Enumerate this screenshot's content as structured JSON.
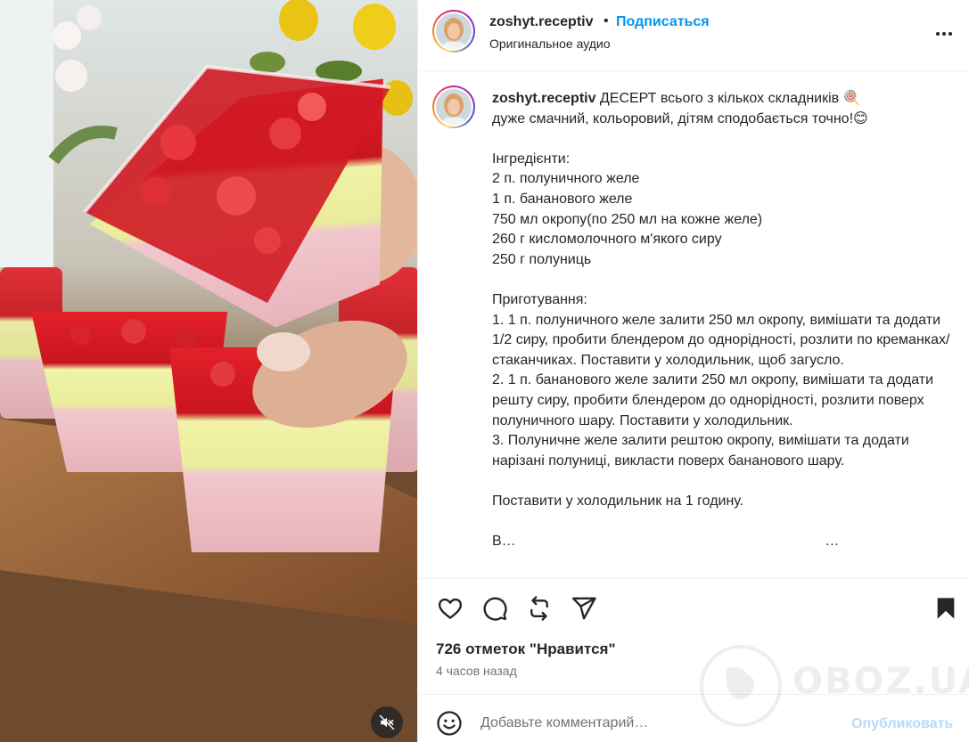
{
  "post": {
    "username": "zoshyt.receptiv",
    "separator": "•",
    "follow_label": "Подписаться",
    "audio_label": "Оригинальное аудио"
  },
  "caption": {
    "username": "zoshyt.receptiv",
    "title": " ДЕСЕРТ всього з кількох складників 🍭",
    "body": "\nдуже смачний, кольоровий, дітям сподобається точно!😊\n\nІнгредієнти:\n2 п. полуничного желе\n1 п. бананового желе\n750 мл окропу(по 250 мл на кожне желе)\n260 г кисломолочного м'якого сиру\n250 г полуниць\n\nПриготування:\n1. 1 п. полуничного желе залити 250 мл окропу, вимішати та додати 1/2 сиру, пробити блендером до однорідності, розлити по креманках/стаканчиках. Поставити у холодильник, щоб загусло.\n2. 1 п. бананового желе залити 250 мл окропу, вимішати та додати решту сиру, пробити блендером до однорідності, розлити поверх полуничного шару. Поставити у холодильник.\n3. Полуничне желе залити рештою окропу, вимішати та додати нарізані полуниці, викласти поверх бананового шару.\n\nПоставити у холодильник на 1 годину.\n\nВ…                                                                              …"
  },
  "stats": {
    "likes": "726 отметок \"Нравится\"",
    "time_ago": "4 часов назад"
  },
  "comment": {
    "placeholder": "Добавьте комментарий…",
    "publish_label": "Опубликовать"
  },
  "watermark": {
    "text": "OBOZ.UA"
  },
  "colors": {
    "follow": "#0095f6",
    "publish_disabled": "#b3dbff",
    "text_primary": "#262626",
    "text_secondary": "#737373"
  },
  "icons": [
    "like-icon",
    "comment-icon",
    "repost-icon",
    "share-icon",
    "bookmark-icon",
    "emoji-icon",
    "more-icon",
    "muted-icon"
  ]
}
